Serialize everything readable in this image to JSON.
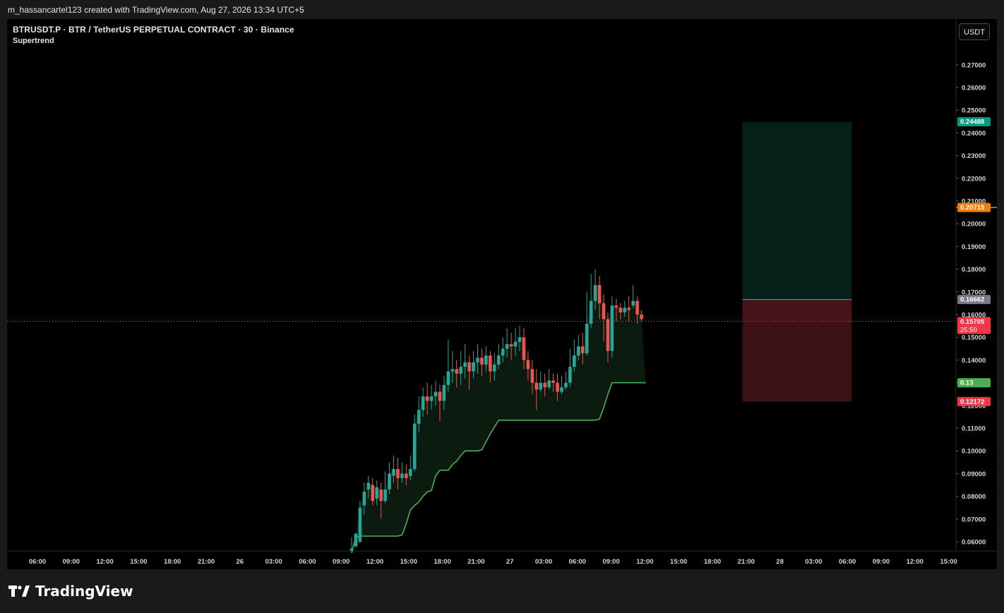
{
  "header": {
    "credit": "m_hassancartel123 created with TradingView.com, Aug 27, 2026 13:34 UTC+5"
  },
  "legend": {
    "title": "BTRUSDT.P · BTR / TetherUS PERPETUAL CONTRACT · 30 · Binance",
    "indicator": "Supertrend"
  },
  "toolbar": {
    "currency": "USDT"
  },
  "brand": {
    "name": "TradingView",
    "logo_icon": "tradingview-logo-icon"
  },
  "colors": {
    "up": "#26a69a",
    "down": "#ef5350",
    "supertrend": "#4caf50",
    "target_zone": "#062019",
    "stop_zone": "#3a1216",
    "alert_line": "#f57c00"
  },
  "chart_data": {
    "type": "candlestick",
    "symbol": "BTRUSDT.P",
    "interval": "30",
    "exchange": "Binance",
    "ylim": [
      0.055,
      0.29
    ],
    "y_ticks": [
      "0.27000",
      "0.26000",
      "0.25000",
      "0.24000",
      "0.23000",
      "0.22000",
      "0.21000",
      "0.20000",
      "0.19000",
      "0.18000",
      "0.17000",
      "0.16000",
      "0.15000",
      "0.14000",
      "0.13000",
      "0.12000",
      "0.11000",
      "0.10000",
      "0.09000",
      "0.08000",
      "0.07000",
      "0.06000"
    ],
    "x_ticks": [
      "06:00",
      "09:00",
      "12:00",
      "15:00",
      "18:00",
      "21:00",
      "26",
      "03:00",
      "06:00",
      "09:00",
      "12:00",
      "15:00",
      "18:00",
      "21:00",
      "27",
      "03:00",
      "06:00",
      "09:00",
      "12:00",
      "15:00",
      "18:00",
      "21:00",
      "28",
      "03:00",
      "06:00",
      "09:00",
      "12:00",
      "15:00"
    ],
    "price_labels": [
      {
        "text": "0.24488",
        "value": 0.24488,
        "color": "#089981",
        "role": "take-profit"
      },
      {
        "text": "0.20715",
        "value": 0.20715,
        "color": "#f57c00",
        "role": "alert-line"
      },
      {
        "text": "0.16662",
        "value": 0.16662,
        "color": "#787b86",
        "role": "entry"
      },
      {
        "text": "0.15705",
        "value": 0.15705,
        "color": "#f23645",
        "role": "last-price",
        "countdown": "25:50"
      },
      {
        "text": "0.13",
        "value": 0.13,
        "color": "#4caf50",
        "role": "supertrend"
      },
      {
        "text": "0.12172",
        "value": 0.12172,
        "color": "#f23645",
        "role": "stop-loss"
      }
    ],
    "position": {
      "entry": 0.16662,
      "target": 0.24488,
      "stop": 0.12172,
      "start_index": 90,
      "end_index": 112
    },
    "alert_line": {
      "value": 0.20715,
      "start_index": 109
    },
    "last_price": 0.15705,
    "candles": [
      [
        0.056,
        0.057,
        0.062,
        0.056
      ],
      [
        0.058,
        0.0635,
        0.064,
        0.0575
      ],
      [
        0.06,
        0.075,
        0.078,
        0.0595
      ],
      [
        0.076,
        0.082,
        0.086,
        0.072
      ],
      [
        0.083,
        0.086,
        0.089,
        0.079
      ],
      [
        0.085,
        0.078,
        0.088,
        0.076
      ],
      [
        0.079,
        0.084,
        0.087,
        0.076
      ],
      [
        0.083,
        0.078,
        0.086,
        0.07
      ],
      [
        0.078,
        0.083,
        0.091,
        0.077
      ],
      [
        0.083,
        0.09,
        0.095,
        0.081
      ],
      [
        0.089,
        0.092,
        0.098,
        0.086
      ],
      [
        0.092,
        0.088,
        0.097,
        0.083
      ],
      [
        0.088,
        0.09,
        0.095,
        0.086
      ],
      [
        0.09,
        0.088,
        0.094,
        0.085
      ],
      [
        0.089,
        0.092,
        0.098,
        0.087
      ],
      [
        0.092,
        0.112,
        0.116,
        0.091
      ],
      [
        0.112,
        0.118,
        0.124,
        0.108
      ],
      [
        0.118,
        0.124,
        0.128,
        0.115
      ],
      [
        0.124,
        0.122,
        0.13,
        0.116
      ],
      [
        0.122,
        0.124,
        0.129,
        0.118
      ],
      [
        0.124,
        0.126,
        0.131,
        0.12
      ],
      [
        0.126,
        0.122,
        0.129,
        0.113
      ],
      [
        0.122,
        0.129,
        0.133,
        0.118
      ],
      [
        0.129,
        0.135,
        0.149,
        0.126
      ],
      [
        0.135,
        0.136,
        0.144,
        0.13
      ],
      [
        0.136,
        0.134,
        0.14,
        0.128
      ],
      [
        0.134,
        0.137,
        0.144,
        0.129
      ],
      [
        0.137,
        0.139,
        0.147,
        0.132
      ],
      [
        0.139,
        0.135,
        0.142,
        0.127
      ],
      [
        0.135,
        0.139,
        0.144,
        0.132
      ],
      [
        0.139,
        0.141,
        0.147,
        0.134
      ],
      [
        0.141,
        0.138,
        0.145,
        0.133
      ],
      [
        0.138,
        0.142,
        0.146,
        0.135
      ],
      [
        0.142,
        0.135,
        0.144,
        0.13
      ],
      [
        0.135,
        0.138,
        0.143,
        0.131
      ],
      [
        0.138,
        0.142,
        0.147,
        0.136
      ],
      [
        0.142,
        0.145,
        0.15,
        0.139
      ],
      [
        0.145,
        0.147,
        0.154,
        0.141
      ],
      [
        0.147,
        0.146,
        0.152,
        0.14
      ],
      [
        0.146,
        0.148,
        0.154,
        0.142
      ],
      [
        0.148,
        0.15,
        0.155,
        0.144
      ],
      [
        0.15,
        0.14,
        0.154,
        0.136
      ],
      [
        0.14,
        0.136,
        0.144,
        0.131
      ],
      [
        0.136,
        0.13,
        0.14,
        0.125
      ],
      [
        0.13,
        0.127,
        0.136,
        0.118
      ],
      [
        0.127,
        0.13,
        0.135,
        0.126
      ],
      [
        0.13,
        0.128,
        0.134,
        0.124
      ],
      [
        0.128,
        0.131,
        0.136,
        0.127
      ],
      [
        0.131,
        0.13,
        0.134,
        0.126
      ],
      [
        0.13,
        0.126,
        0.134,
        0.122
      ],
      [
        0.126,
        0.128,
        0.133,
        0.125
      ],
      [
        0.128,
        0.13,
        0.135,
        0.127
      ],
      [
        0.13,
        0.137,
        0.145,
        0.128
      ],
      [
        0.137,
        0.142,
        0.149,
        0.135
      ],
      [
        0.142,
        0.146,
        0.151,
        0.14
      ],
      [
        0.146,
        0.143,
        0.152,
        0.138
      ],
      [
        0.143,
        0.156,
        0.17,
        0.142
      ],
      [
        0.156,
        0.166,
        0.178,
        0.154
      ],
      [
        0.166,
        0.173,
        0.18,
        0.162
      ],
      [
        0.173,
        0.165,
        0.177,
        0.158
      ],
      [
        0.165,
        0.158,
        0.169,
        0.148
      ],
      [
        0.158,
        0.144,
        0.161,
        0.139
      ],
      [
        0.144,
        0.164,
        0.168,
        0.141
      ],
      [
        0.164,
        0.163,
        0.167,
        0.157
      ],
      [
        0.163,
        0.161,
        0.165,
        0.158
      ],
      [
        0.161,
        0.163,
        0.166,
        0.159
      ],
      [
        0.163,
        0.162,
        0.168,
        0.157
      ],
      [
        0.164,
        0.166,
        0.173,
        0.163
      ],
      [
        0.166,
        0.16,
        0.168,
        0.156
      ],
      [
        0.16,
        0.158,
        0.162,
        0.157
      ]
    ],
    "supertrend": [
      [
        0,
        0.055
      ],
      [
        1,
        0.062
      ],
      [
        2,
        0.0625
      ],
      [
        3,
        0.0625
      ],
      [
        4,
        0.0625
      ],
      [
        5,
        0.0625
      ],
      [
        6,
        0.0625
      ],
      [
        7,
        0.0625
      ],
      [
        8,
        0.0625
      ],
      [
        9,
        0.0625
      ],
      [
        10,
        0.0625
      ],
      [
        11,
        0.0625
      ],
      [
        12,
        0.063
      ],
      [
        13,
        0.068
      ],
      [
        14,
        0.074
      ],
      [
        15,
        0.076
      ],
      [
        16,
        0.0775
      ],
      [
        17,
        0.08
      ],
      [
        18,
        0.082
      ],
      [
        19,
        0.0825
      ],
      [
        20,
        0.089
      ],
      [
        21,
        0.0915
      ],
      [
        22,
        0.0915
      ],
      [
        23,
        0.0915
      ],
      [
        24,
        0.094
      ],
      [
        25,
        0.0955
      ],
      [
        26,
        0.098
      ],
      [
        27,
        0.1
      ],
      [
        28,
        0.1
      ],
      [
        29,
        0.1
      ],
      [
        30,
        0.1
      ],
      [
        31,
        0.1005
      ],
      [
        32,
        0.104
      ],
      [
        33,
        0.1075
      ],
      [
        34,
        0.1105
      ],
      [
        35,
        0.1135
      ],
      [
        45,
        0.1135
      ],
      [
        50,
        0.1135
      ],
      [
        55,
        0.1135
      ],
      [
        58,
        0.1135
      ],
      [
        59,
        0.114
      ],
      [
        60,
        0.119
      ],
      [
        61,
        0.125
      ],
      [
        62,
        0.13
      ],
      [
        66,
        0.13
      ],
      [
        70,
        0.13
      ]
    ]
  }
}
